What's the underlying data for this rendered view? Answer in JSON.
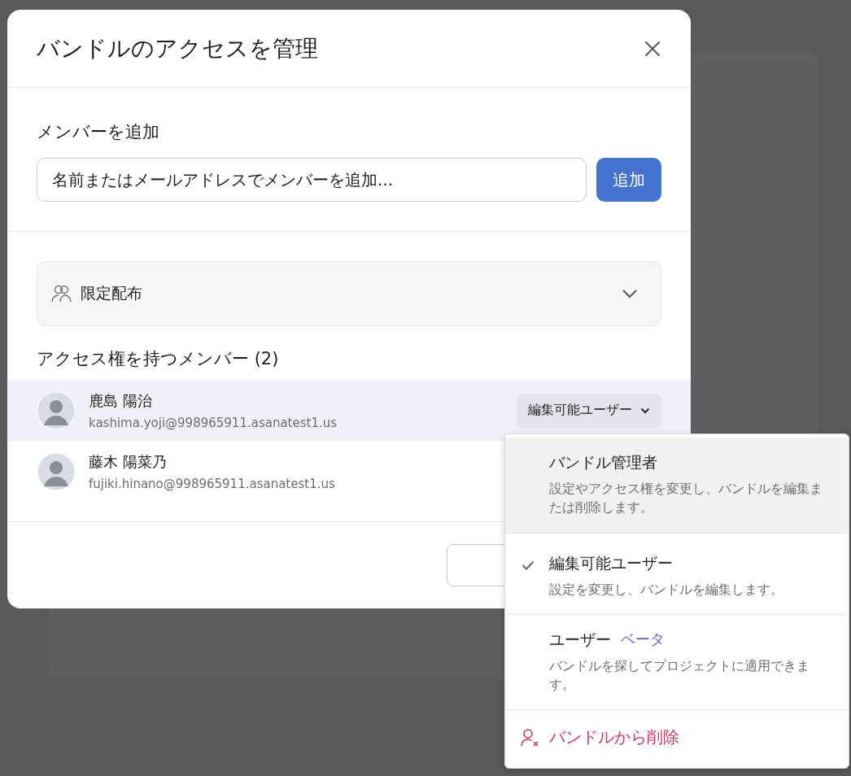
{
  "dialog": {
    "title": "バンドルのアクセスを管理"
  },
  "add_member": {
    "label": "メンバーを追加",
    "placeholder": "名前またはメールアドレスでメンバーを追加...",
    "button": "追加"
  },
  "distribution": {
    "label": "限定配布",
    "expanded": false
  },
  "members_heading": "アクセス権を持つメンバー (2)",
  "members": [
    {
      "name": "鹿島 陽治",
      "email": "kashima.yoji@998965911.asanatest1.us",
      "highlighted": true,
      "role": "編集可能ユーザー"
    },
    {
      "name": "藤木 陽菜乃",
      "email": "fujiki.hinano@998965911.asanatest1.us",
      "highlighted": false
    }
  ],
  "role_menu": [
    {
      "kind": "role",
      "title": "バンドル管理者",
      "description": "設定やアクセス権を変更し、バンドルを編集または削除します。",
      "selected": false,
      "highlighted": true
    },
    {
      "kind": "role",
      "title": "編集可能ユーザー",
      "description": "設定を変更し、バンドルを編集します。",
      "selected": true,
      "highlighted": false
    },
    {
      "kind": "role",
      "title": "ユーザー",
      "tag": "ベータ",
      "description": "バンドルを探してプロジェクトに適用できます。",
      "selected": false,
      "highlighted": false
    },
    {
      "kind": "danger",
      "title": "バンドルから削除"
    }
  ]
}
